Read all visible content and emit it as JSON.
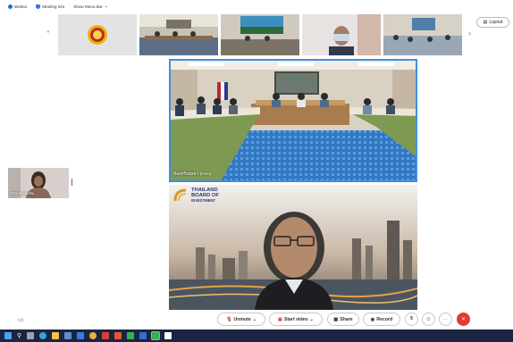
{
  "topbar": {
    "webex": "Webex",
    "meeting_info": "Meeting info",
    "show_menu": "Show Menu Bar"
  },
  "layout_label": "Layout",
  "main_video": {
    "name": "ห้องศรีอยุธยา (Host)"
  },
  "second_video": {
    "logo_line1": "THAILAND",
    "logo_line2": "BOARD OF",
    "logo_line3": "INVESTMENT"
  },
  "self_view": {
    "name": "BOI Sunantha"
  },
  "toolbar": {
    "unmute": "Unmute",
    "start_video": "Start video",
    "share": "Share",
    "record": "Record"
  },
  "colors": {
    "accent": "#3d8fe0",
    "end_call": "#e03a3a",
    "taskbar": "#1b2440"
  }
}
